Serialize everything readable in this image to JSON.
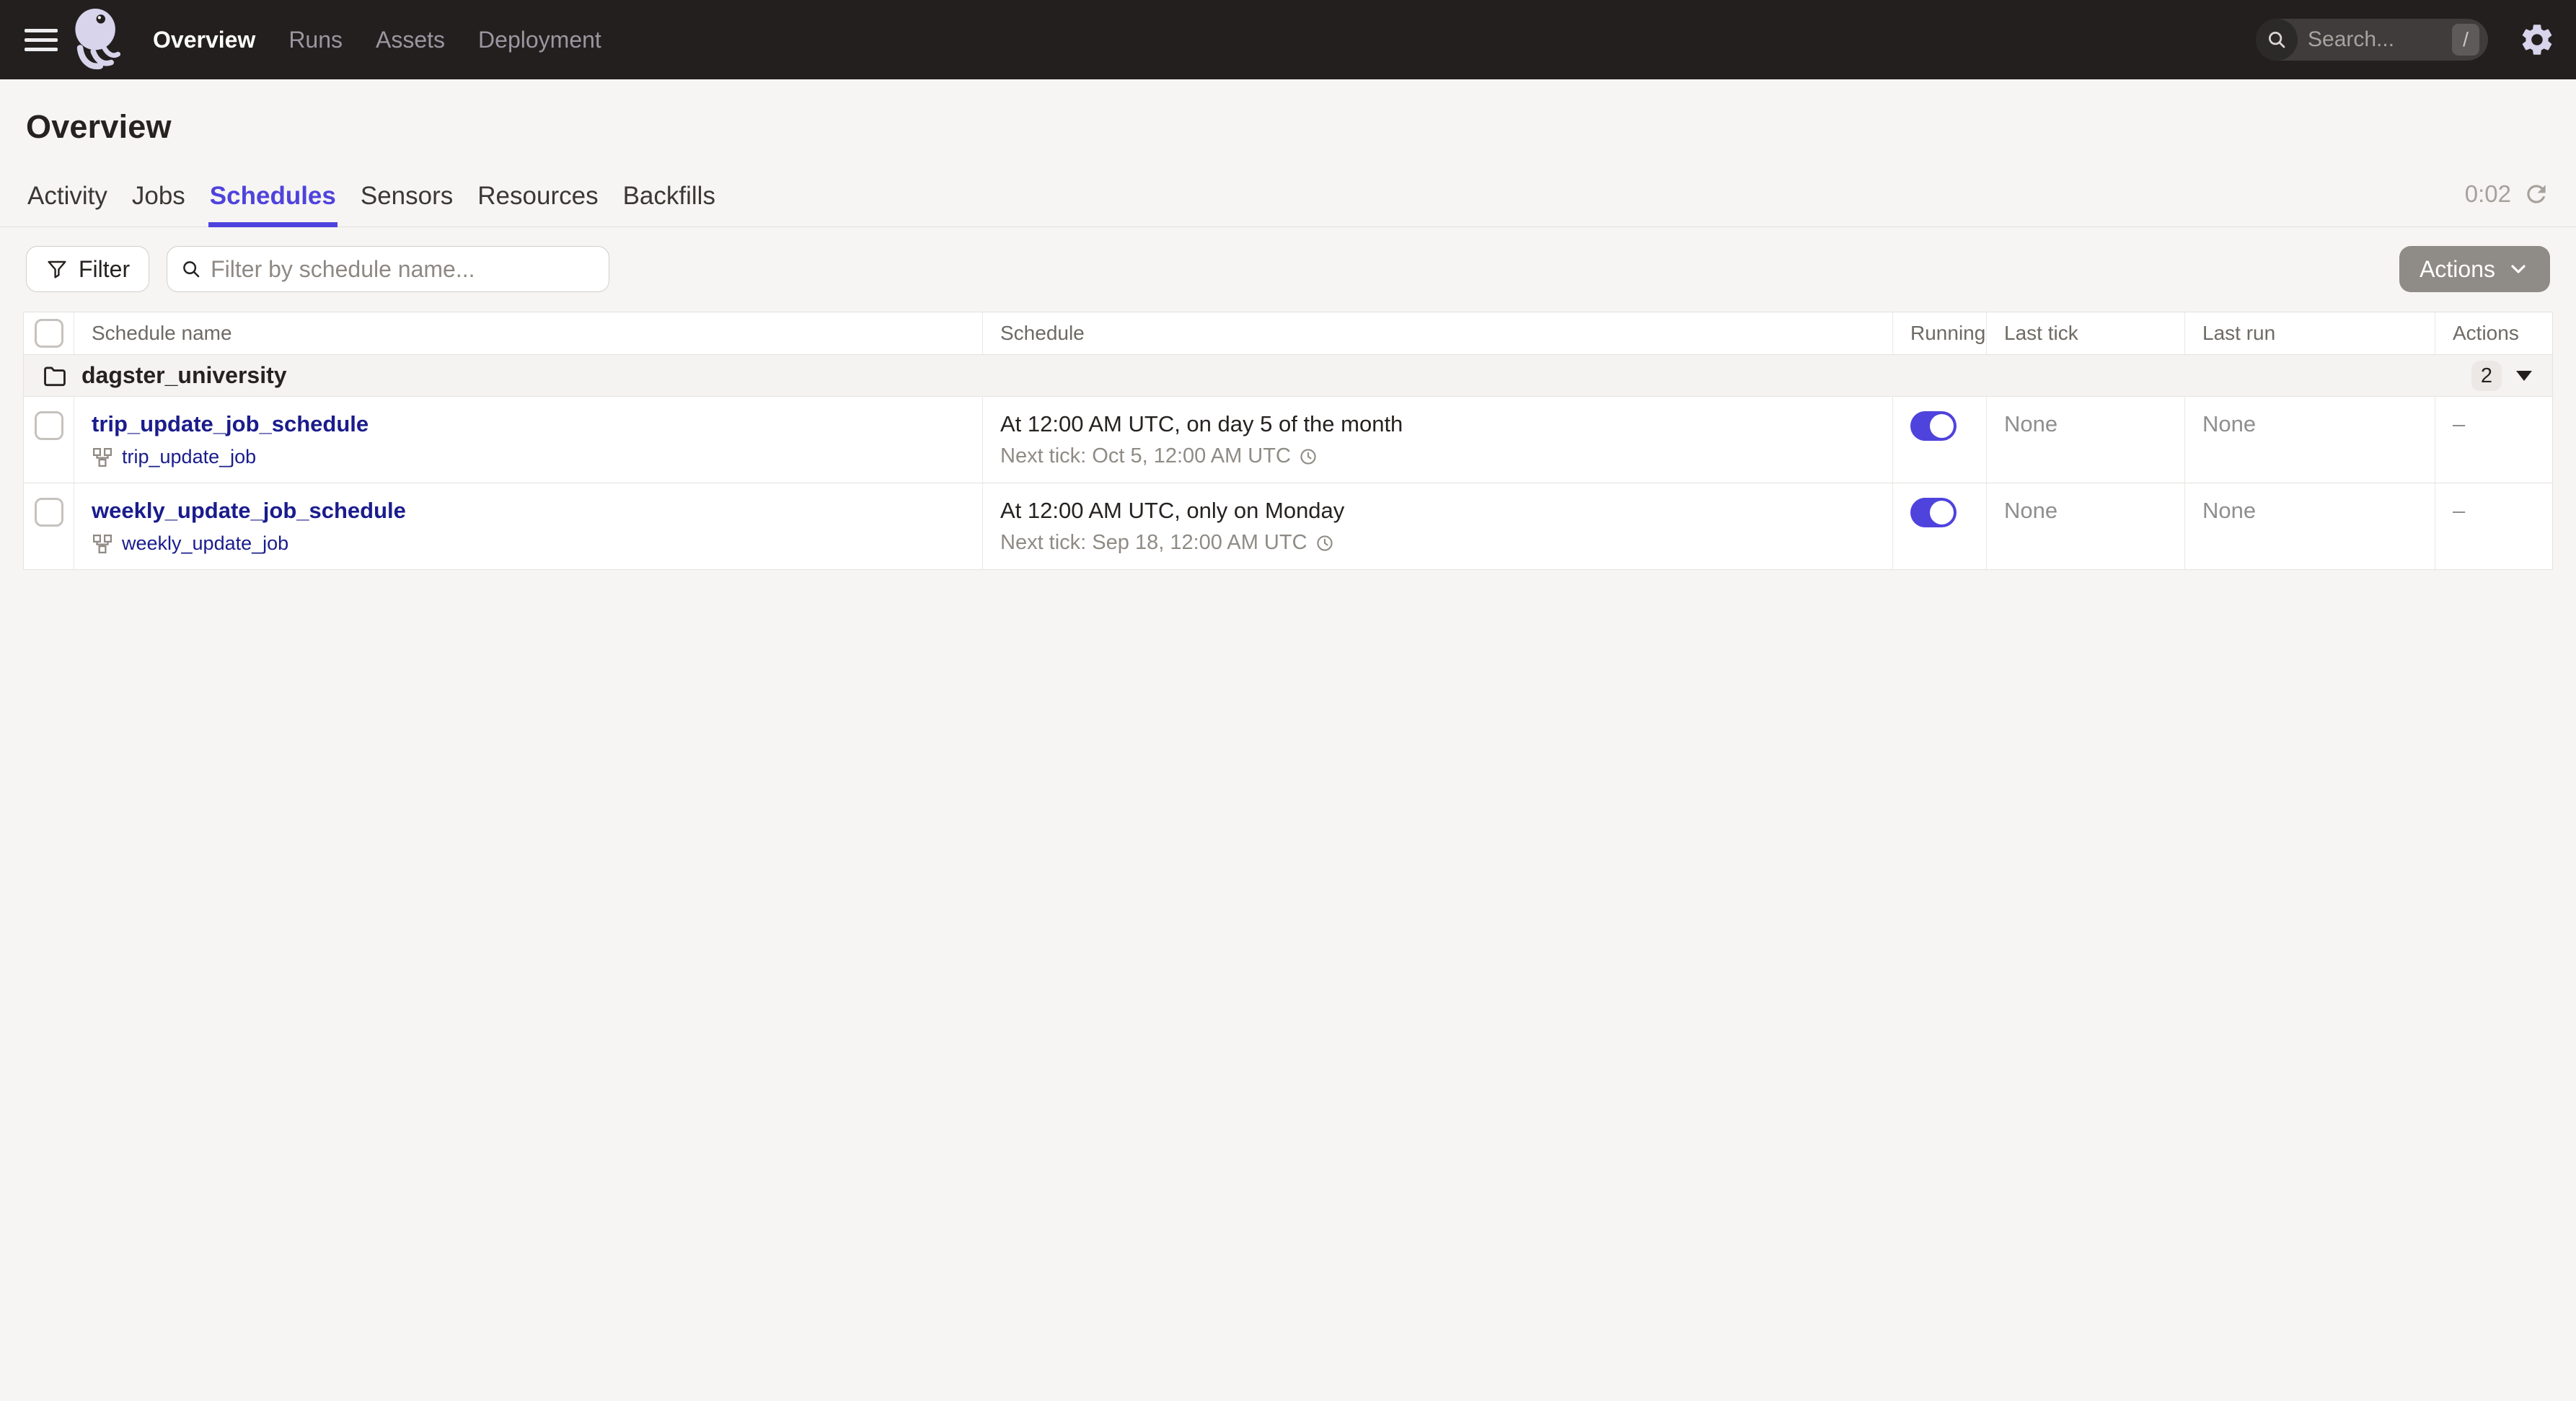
{
  "topnav": {
    "items": [
      {
        "label": "Overview",
        "active": true
      },
      {
        "label": "Runs",
        "active": false
      },
      {
        "label": "Assets",
        "active": false
      },
      {
        "label": "Deployment",
        "active": false
      }
    ],
    "search": {
      "placeholder": "Search...",
      "shortcut": "/"
    }
  },
  "page": {
    "title": "Overview"
  },
  "tabs": [
    {
      "label": "Activity",
      "active": false
    },
    {
      "label": "Jobs",
      "active": false
    },
    {
      "label": "Schedules",
      "active": true
    },
    {
      "label": "Sensors",
      "active": false
    },
    {
      "label": "Resources",
      "active": false
    },
    {
      "label": "Backfills",
      "active": false
    }
  ],
  "refresh": {
    "countdown": "0:02"
  },
  "toolbar": {
    "filter_label": "Filter",
    "search_placeholder": "Filter by schedule name...",
    "actions_label": "Actions"
  },
  "table": {
    "columns": [
      "Schedule name",
      "Schedule",
      "Running",
      "Last tick",
      "Last run",
      "Actions"
    ],
    "group": {
      "name": "dagster_university",
      "count": "2"
    },
    "rows": [
      {
        "name": "trip_update_job_schedule",
        "job": "trip_update_job",
        "schedule": "At 12:00 AM UTC, on day 5 of the month",
        "next_tick": "Next tick: Oct 5, 12:00 AM UTC",
        "running": true,
        "last_tick": "None",
        "last_run": "None",
        "actions": "–"
      },
      {
        "name": "weekly_update_job_schedule",
        "job": "weekly_update_job",
        "schedule": "At 12:00 AM UTC, only on Monday",
        "next_tick": "Next tick: Sep 18, 12:00 AM UTC",
        "running": true,
        "last_tick": "None",
        "last_run": "None",
        "actions": "–"
      }
    ]
  },
  "colors": {
    "accent": "#4F43DD",
    "link": "#1A1C8C",
    "topnav_bg": "#231F1E"
  }
}
